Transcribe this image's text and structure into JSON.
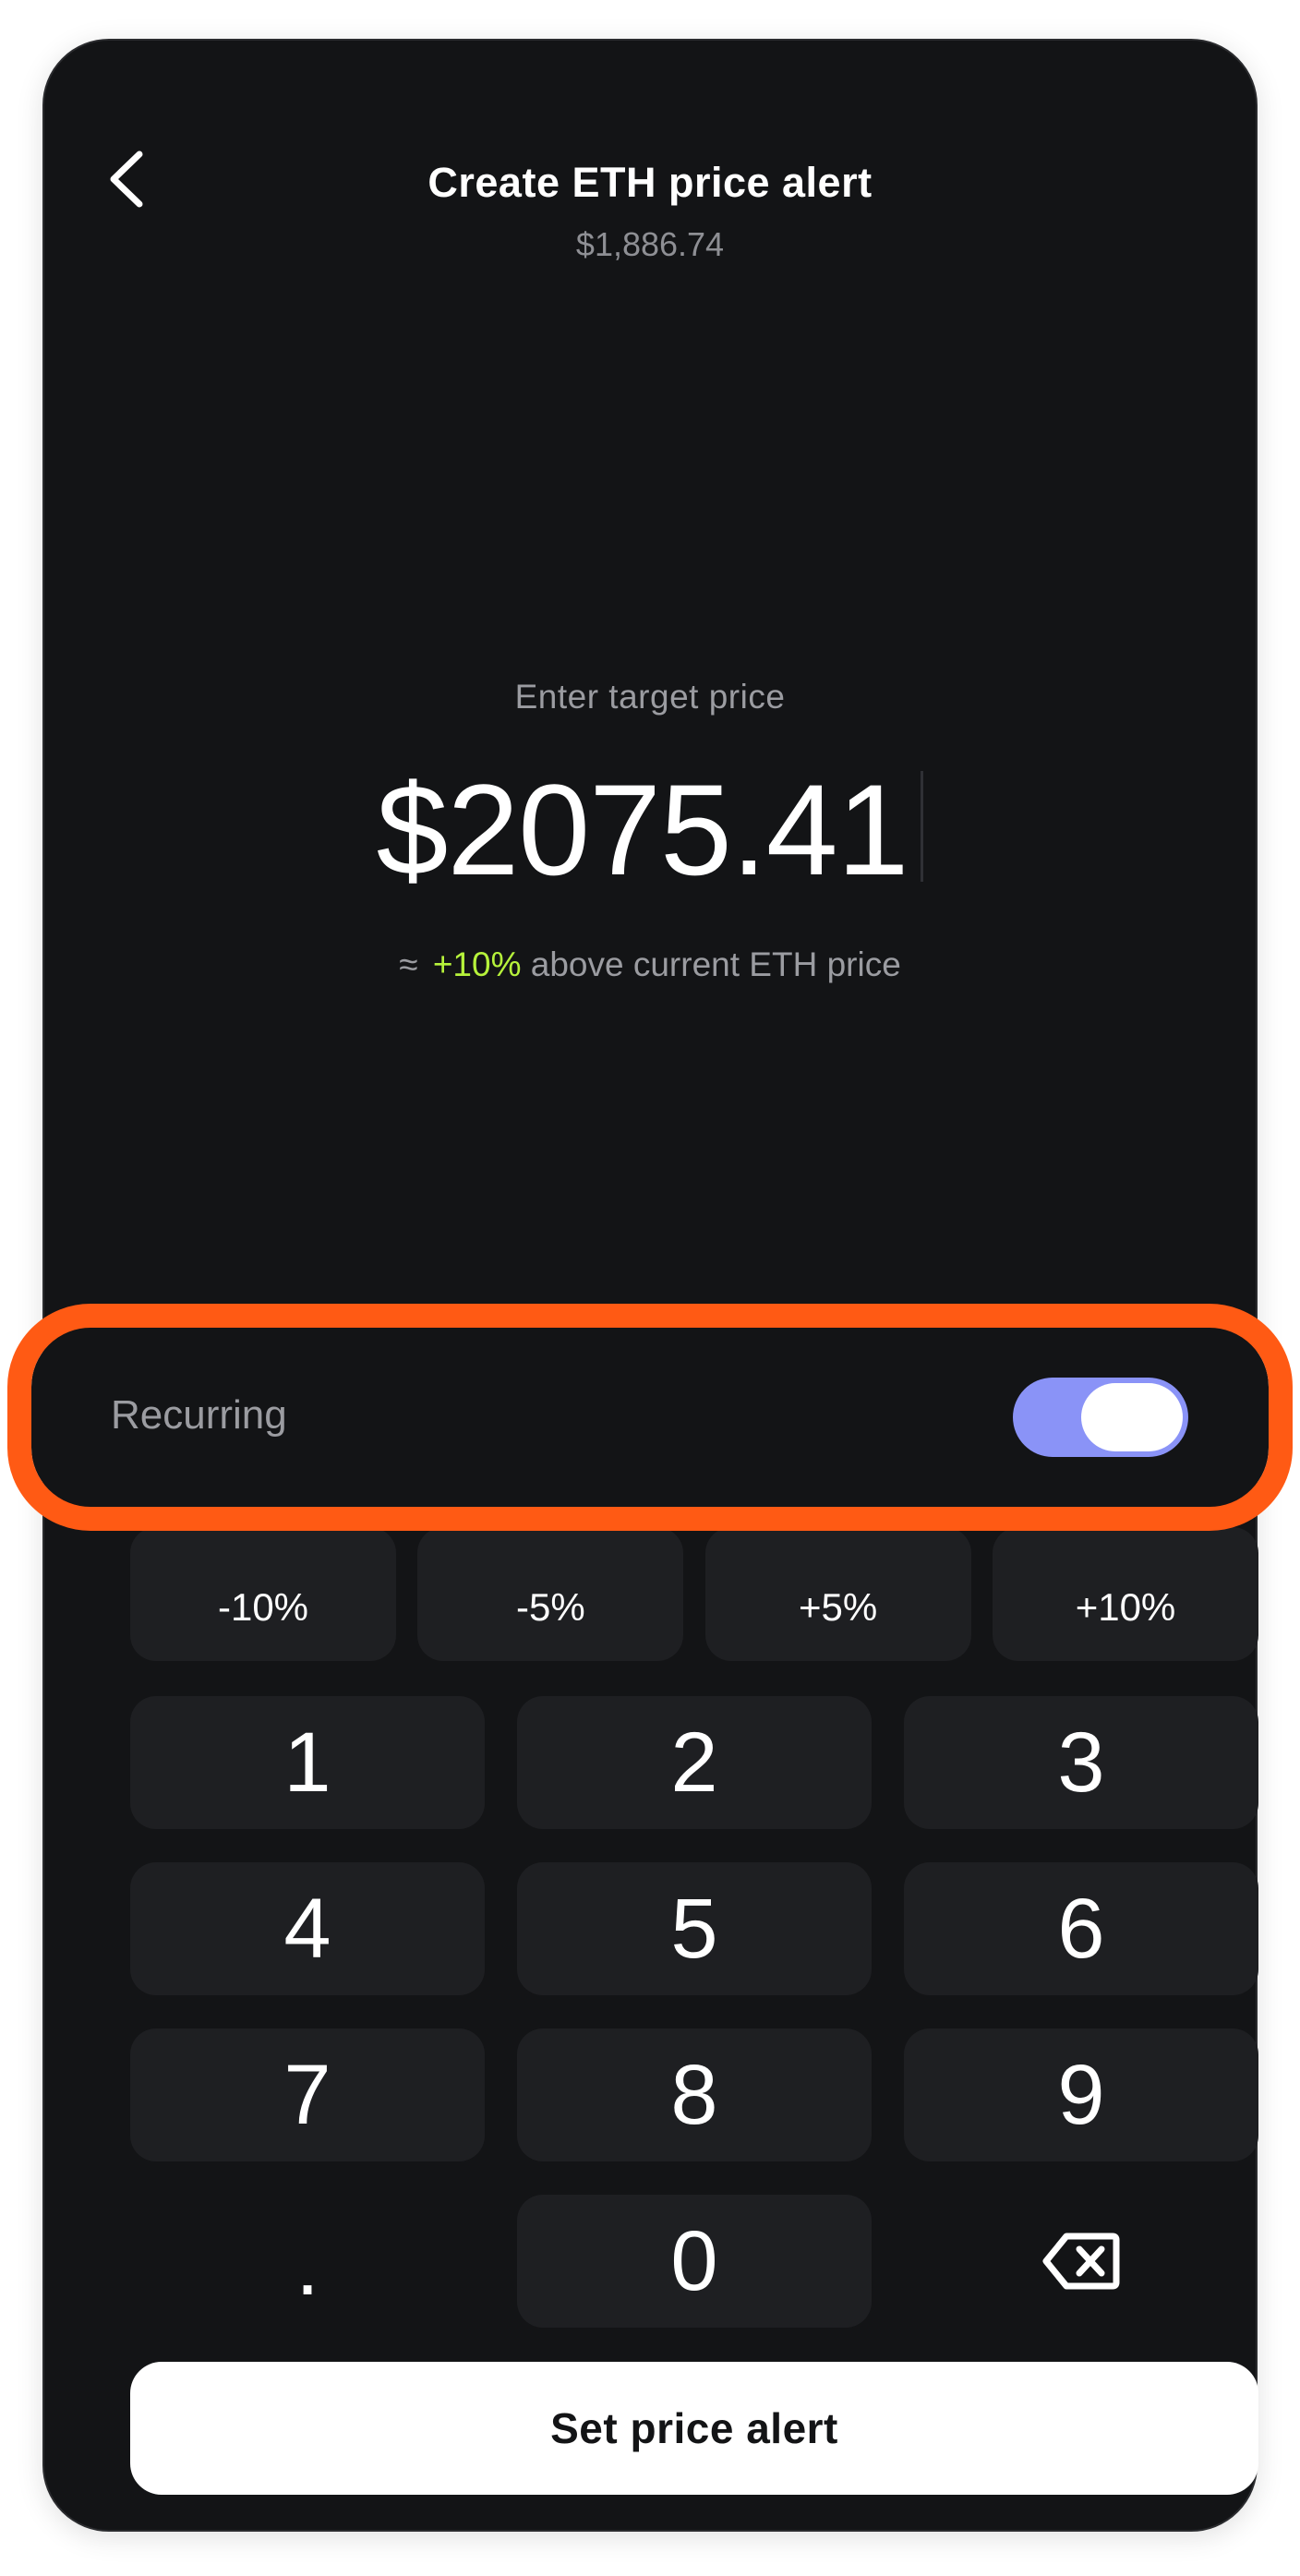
{
  "header": {
    "title": "Create ETH price alert",
    "current_price": "$1,886.74"
  },
  "target": {
    "prompt": "Enter target price",
    "value": "$2075.41",
    "approx_symbol": "≈",
    "diff_pct": "+10%",
    "diff_text": "above current ETH price"
  },
  "recurring": {
    "label": "Recurring",
    "enabled": true,
    "toggle_color": "#8a93f7",
    "highlight_color": "#ff5a14"
  },
  "chips": [
    "-10%",
    "-5%",
    "+5%",
    "+10%"
  ],
  "keypad": {
    "k1": "1",
    "k2": "2",
    "k3": "3",
    "k4": "4",
    "k5": "5",
    "k6": "6",
    "k7": "7",
    "k8": "8",
    "k9": "9",
    "dot": ".",
    "k0": "0"
  },
  "cta": {
    "label": "Set price alert"
  },
  "colors": {
    "background": "#131416",
    "key_bg": "#1e1f22",
    "accent_green": "#b6f23b"
  }
}
